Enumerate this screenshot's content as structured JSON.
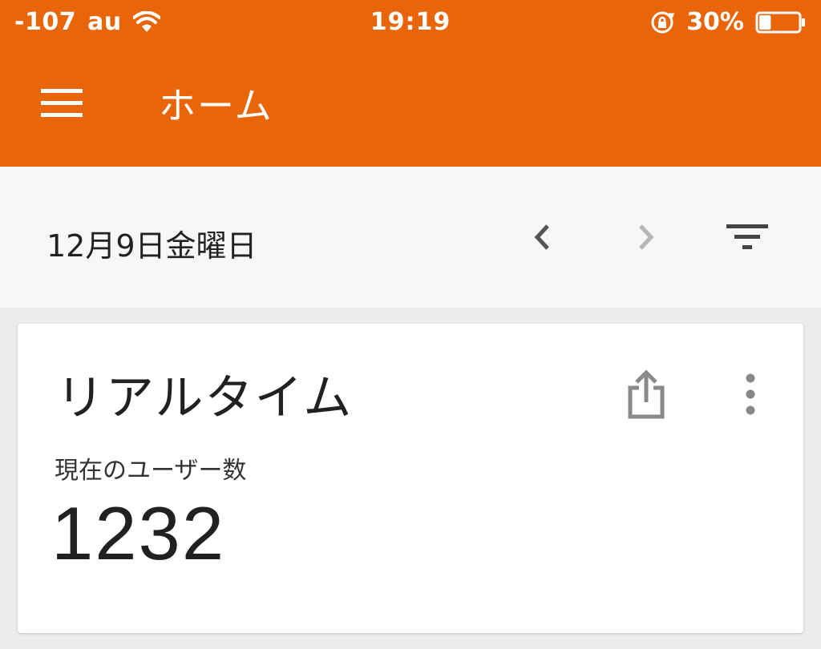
{
  "status_bar": {
    "signal": "-107",
    "carrier": "au",
    "time": "19:19",
    "battery_percent": "30%",
    "battery_level": 0.3,
    "icons": [
      "wifi-icon",
      "rotation-lock-icon",
      "battery-icon"
    ]
  },
  "toolbar": {
    "title": "ホーム",
    "menu_icon": "hamburger-menu-icon"
  },
  "date_bar": {
    "date": "12月9日金曜日",
    "prev_icon": "chevron-left-icon",
    "next_icon": "chevron-right-icon",
    "filter_icon": "filter-icon"
  },
  "card": {
    "title": "リアルタイム",
    "metric_label": "現在のユーザー数",
    "metric_value": "1232",
    "share_icon": "share-icon",
    "more_icon": "more-vert-icon"
  },
  "colors": {
    "header": "#e8650a",
    "background": "#ececec",
    "date_bar": "#f7f7f7",
    "card": "#ffffff"
  }
}
